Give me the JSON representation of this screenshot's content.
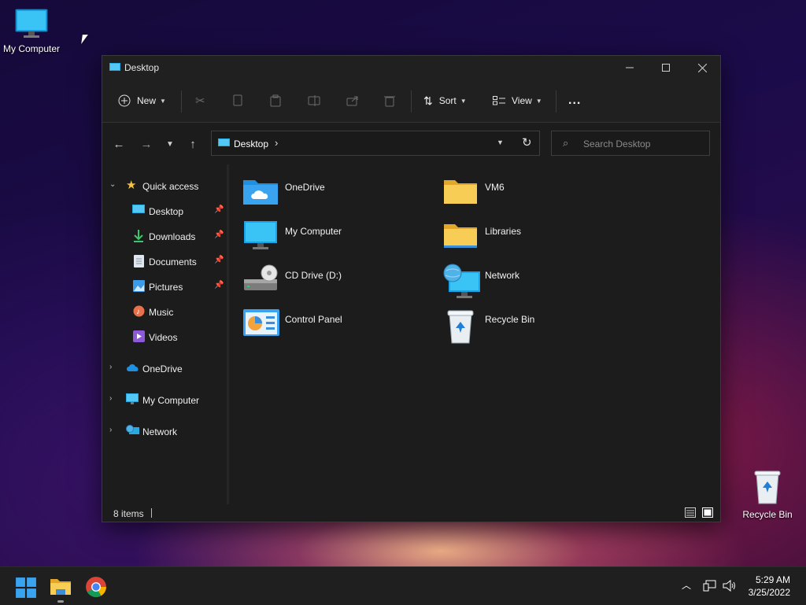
{
  "desktop": {
    "icons": [
      {
        "label": "My Computer",
        "icon": "monitor-icon"
      },
      {
        "label": "Recycle Bin",
        "icon": "recycle-bin-icon"
      }
    ]
  },
  "window": {
    "title": "Desktop",
    "toolbar": {
      "new_label": "New",
      "sort_label": "Sort",
      "view_label": "View",
      "more_label": "..."
    },
    "address": {
      "crumb": "Desktop"
    },
    "search": {
      "placeholder": "Search Desktop"
    },
    "sidebar": {
      "quick_access": "Quick access",
      "items": [
        {
          "label": "Desktop",
          "icon": "desktop-icon",
          "pinned": true
        },
        {
          "label": "Downloads",
          "icon": "download-icon",
          "pinned": true
        },
        {
          "label": "Documents",
          "icon": "documents-icon",
          "pinned": true
        },
        {
          "label": "Pictures",
          "icon": "pictures-icon",
          "pinned": true
        },
        {
          "label": "Music",
          "icon": "music-icon",
          "pinned": false
        },
        {
          "label": "Videos",
          "icon": "videos-icon",
          "pinned": false
        }
      ],
      "roots": [
        {
          "label": "OneDrive",
          "icon": "cloud-icon"
        },
        {
          "label": "My Computer",
          "icon": "monitor-icon"
        },
        {
          "label": "Network",
          "icon": "network-icon"
        }
      ]
    },
    "items": [
      {
        "label": "OneDrive",
        "icon": "onedrive-folder-icon"
      },
      {
        "label": "VM6",
        "icon": "folder-icon"
      },
      {
        "label": "My Computer",
        "icon": "monitor-icon"
      },
      {
        "label": "Libraries",
        "icon": "folder-icon"
      },
      {
        "label": "CD Drive (D:)",
        "icon": "cd-drive-icon"
      },
      {
        "label": "Network",
        "icon": "network-icon"
      },
      {
        "label": "Control Panel",
        "icon": "control-panel-icon"
      },
      {
        "label": "Recycle Bin",
        "icon": "recycle-bin-icon"
      }
    ],
    "status": {
      "count": "8 items"
    }
  },
  "taskbar": {
    "apps": [
      {
        "icon": "start-icon"
      },
      {
        "icon": "file-explorer-icon"
      },
      {
        "icon": "chrome-icon"
      }
    ],
    "time": "5:29 AM",
    "date": "3/25/2022"
  },
  "colors": {
    "accent": "#0078d4",
    "window_bg": "#1c1c1c",
    "folder": "#f5c542"
  }
}
